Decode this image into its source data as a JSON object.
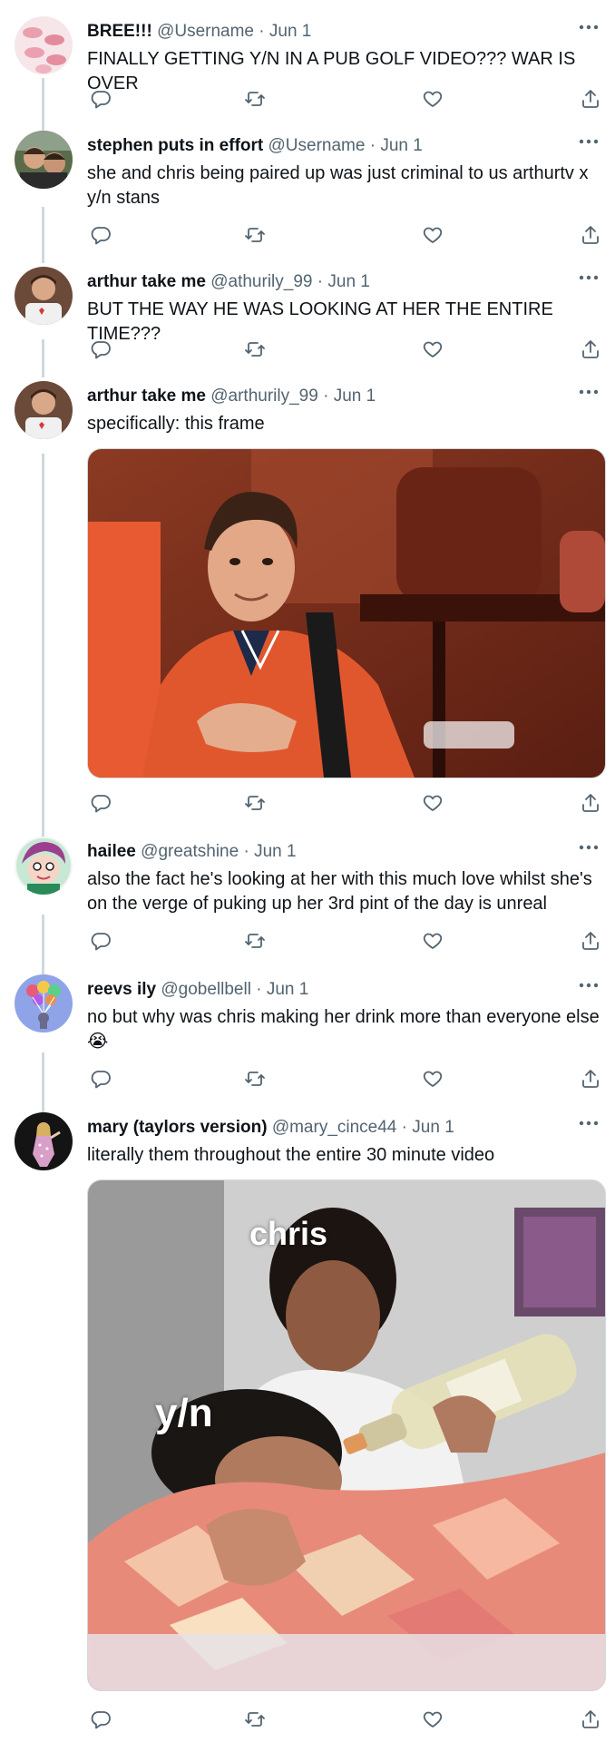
{
  "colors": {
    "text": "#0f1419",
    "secondary": "#536471",
    "thread_line": "#cfd9de",
    "icon": "#536471"
  },
  "tweets": [
    {
      "name": "BREE!!!",
      "handle": "@Username",
      "dot": "·",
      "date": "Jun 1",
      "text": "FINALLY GETTING Y/N IN A PUB GOLF VIDEO??? WAR IS OVER",
      "avatar_icon": "lips-avatar"
    },
    {
      "name": "stephen puts in effort",
      "handle": "@Username",
      "dot": "·",
      "date": "Jun 1",
      "text": "she and chris being paired up was just criminal to us arthurtv x y/n stans",
      "avatar_icon": "two-people-avatar"
    },
    {
      "name": "arthur take me",
      "handle": "@athurily_99",
      "dot": "·",
      "date": "Jun 1",
      "text": "BUT THE WAY HE WAS LOOKING AT HER THE ENTIRE TIME???",
      "avatar_icon": "person-avatar"
    },
    {
      "name": "arthur take me",
      "handle": "@arthurily_99",
      "dot": "·",
      "date": "Jun 1",
      "text": "specifically: this frame",
      "avatar_icon": "person-avatar",
      "media": "photo of a young man in an orange football shirt smiling at the camera"
    },
    {
      "name": "hailee",
      "handle": "@greatshine",
      "dot": "·",
      "date": "Jun 1",
      "text": "also the fact he's looking at her with this much love whilst she's on the verge of puking up her 3rd pint of the day is unreal",
      "avatar_icon": "cartoon-avatar"
    },
    {
      "name": "reevs ily",
      "handle": "@gobellbell",
      "dot": "·",
      "date": "Jun 1",
      "text": "no but why was chris making her drink more than everyone else",
      "emoji": "😭",
      "avatar_icon": "balloons-avatar"
    },
    {
      "name": "mary (taylors version)",
      "handle": "@mary_cince44",
      "dot": "·",
      "date": "Jun 1",
      "text": "literally them throughout the entire 30 minute video",
      "avatar_icon": "performer-avatar",
      "media": "meme photo",
      "meme_labels": [
        "chris",
        "y/n"
      ]
    }
  ]
}
